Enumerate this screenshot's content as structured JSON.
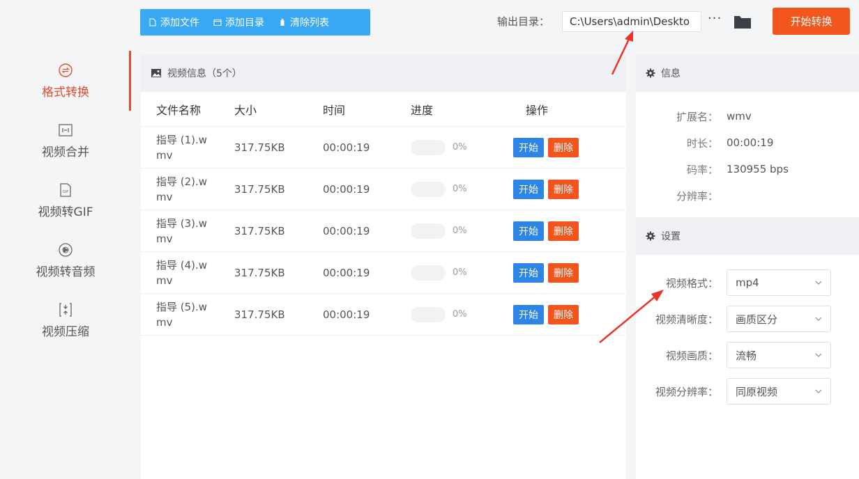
{
  "toolbar": {
    "add_file": "添加文件",
    "add_dir": "添加目录",
    "clear_list": "清除列表",
    "output_label": "输出目录：",
    "output_path": "C:\\Users\\admin\\Deskto",
    "more": "···",
    "start_convert": "开始转换"
  },
  "sidebar": {
    "items": [
      {
        "label": "格式转换",
        "icon": "format-convert-icon",
        "active": true
      },
      {
        "label": "视频合并",
        "icon": "merge-icon"
      },
      {
        "label": "视频转GIF",
        "icon": "gif-icon"
      },
      {
        "label": "视频转音频",
        "icon": "audio-icon"
      },
      {
        "label": "视频压缩",
        "icon": "compress-icon"
      }
    ]
  },
  "main": {
    "header": "视频信息（5个）",
    "columns": {
      "name": "文件名称",
      "size": "大小",
      "time": "时间",
      "progress": "进度",
      "ops": "操作"
    },
    "rows": [
      {
        "name_l1": "指导 (1).w",
        "name_l2": "mv",
        "size": "317.75KB",
        "time": "00:00:19",
        "progress": "0%"
      },
      {
        "name_l1": "指导 (2).w",
        "name_l2": "mv",
        "size": "317.75KB",
        "time": "00:00:19",
        "progress": "0%"
      },
      {
        "name_l1": "指导 (3).w",
        "name_l2": "mv",
        "size": "317.75KB",
        "time": "00:00:19",
        "progress": "0%"
      },
      {
        "name_l1": "指导 (4).w",
        "name_l2": "mv",
        "size": "317.75KB",
        "time": "00:00:19",
        "progress": "0%"
      },
      {
        "name_l1": "指导 (5).w",
        "name_l2": "mv",
        "size": "317.75KB",
        "time": "00:00:19",
        "progress": "0%"
      }
    ],
    "op_start": "开始",
    "op_delete": "删除"
  },
  "info": {
    "header": "信息",
    "ext_label": "扩展名：",
    "ext_value": "wmv",
    "dur_label": "时长：",
    "dur_value": "00:00:19",
    "rate_label": "码率：",
    "rate_value": "130955 bps",
    "res_label": "分辨率：",
    "res_value": ""
  },
  "settings": {
    "header": "设置",
    "format_label": "视频格式：",
    "format_value": "mp4",
    "clarity_label": "视频清晰度：",
    "clarity_value": "画质区分",
    "quality_label": "视频画质：",
    "quality_value": "流畅",
    "resolution_label": "视频分辨率：",
    "resolution_value": "同原视频"
  },
  "colors": {
    "accent_blue": "#3aa9f5",
    "accent_orange": "#f2561d",
    "active_red": "#e44a2f",
    "btn_blue": "#2d86e5"
  }
}
